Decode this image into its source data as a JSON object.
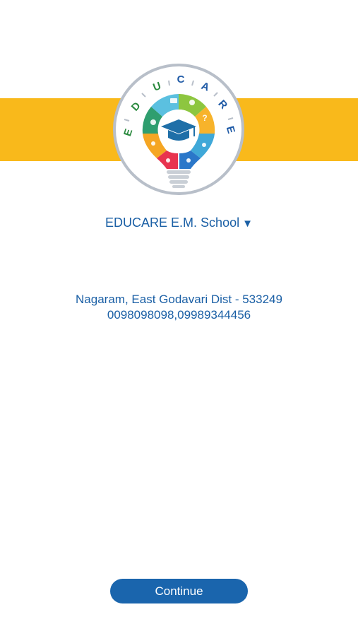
{
  "logo": {
    "letters": [
      "E",
      "D",
      "U",
      "C",
      "A",
      "R",
      "E"
    ],
    "icon": "lightbulb-graduation-cap-icon"
  },
  "school": {
    "name": "EDUCARE E.M. School",
    "dropdown_icon": "▼"
  },
  "address": {
    "line1": "Nagaram, East Godavari Dist - 533249",
    "phones": "0098098098,09989344456"
  },
  "actions": {
    "continue_label": "Continue"
  },
  "colors": {
    "banner": "#f9b91b",
    "text_blue": "#1a5fa5",
    "button_blue": "#1a65ad"
  }
}
